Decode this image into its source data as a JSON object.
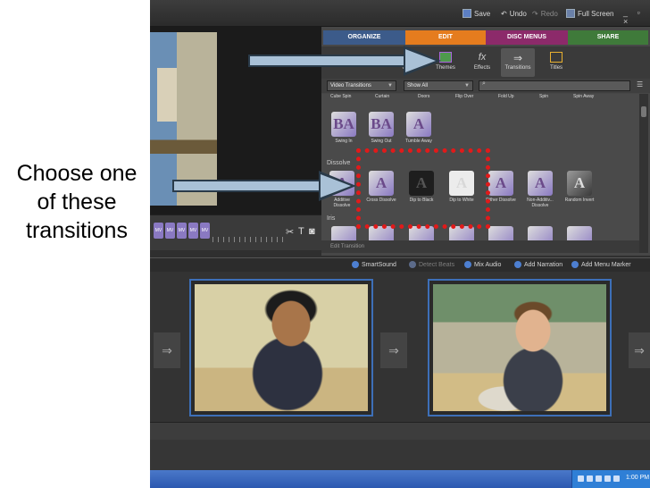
{
  "caption": "Choose one of these transitions",
  "titlebar": {
    "save": "Save",
    "undo": "Undo",
    "redo": "Redo",
    "full_screen": "Full Screen",
    "window_controls": "_ ▫ ×"
  },
  "tabs": [
    {
      "label": "ORGANIZE",
      "color": "#3c5b8a"
    },
    {
      "label": "EDIT",
      "color": "#e57c1e"
    },
    {
      "label": "DISC MENUS",
      "color": "#8c2a6a"
    },
    {
      "label": "SHARE",
      "color": "#3f7a3a"
    }
  ],
  "tools": {
    "project": "oject",
    "themes": "Themes",
    "effects": "Effects",
    "effects_icon": "fx",
    "transitions": "Transitions",
    "titles": "Titles"
  },
  "filters": {
    "category": "Video Transitions",
    "show": "Show All"
  },
  "gallery": {
    "top_row_labels": [
      "Cube Spin",
      "Curtain",
      "Doors",
      "Flip Over",
      "Fold Up",
      "Spin",
      "Spin Away"
    ],
    "row1": [
      {
        "label": "Swing In",
        "glyph": "BA"
      },
      {
        "label": "Swing Out",
        "glyph": "BA"
      },
      {
        "label": "Tumble Away",
        "glyph": "A"
      }
    ],
    "dissolve_group": "Dissolve",
    "dissolve": [
      {
        "label": "Additive Dissolve",
        "glyph": "A"
      },
      {
        "label": "Cross Dissolve",
        "glyph": "A"
      },
      {
        "label": "Dip to Black",
        "glyph": "A"
      },
      {
        "label": "Dip to White",
        "glyph": "A"
      },
      {
        "label": "Dither Dissolve",
        "glyph": "A"
      },
      {
        "label": "Non-Additiv... Dissolve",
        "glyph": "A"
      },
      {
        "label": "Random Invert",
        "glyph": "A"
      }
    ],
    "iris_group": "Iris",
    "edit_transition": "Edit Transition"
  },
  "sound_bar": {
    "smartsound": "SmartSound",
    "detect_beats": "Detect Beats",
    "mix_audio": "Mix Audio",
    "add_narration": "Add Narration",
    "add_menu_marker": "Add Menu Marker"
  },
  "clock": "1:00 PM"
}
